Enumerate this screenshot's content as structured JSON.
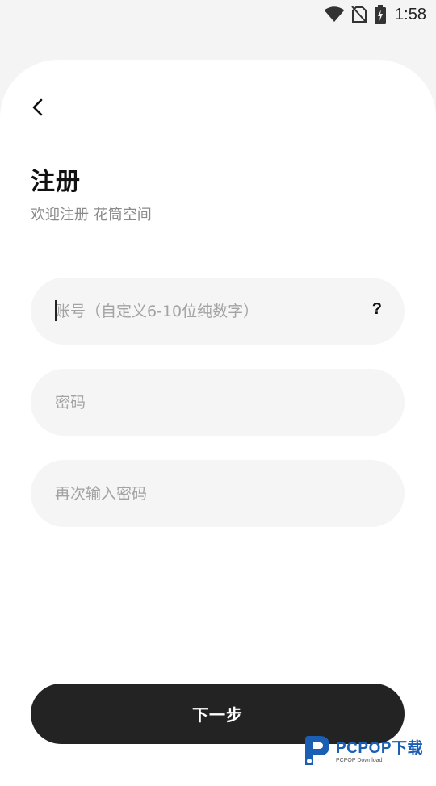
{
  "status_bar": {
    "time": "1:58",
    "icons": [
      "wifi-icon",
      "no-sim-icon",
      "battery-charging-icon"
    ]
  },
  "header": {
    "back_icon": "chevron-left-icon",
    "title": "注册",
    "subtitle": "欢迎注册 花筒空间"
  },
  "form": {
    "account_placeholder": "账号（自定义6-10位纯数字）",
    "account_value": "",
    "help_label": "?",
    "password_placeholder": "密码",
    "password_value": "",
    "confirm_placeholder": "再次输入密码",
    "confirm_value": ""
  },
  "actions": {
    "next_label": "下一步"
  },
  "watermark": {
    "main": "PCPOP下载",
    "sub": "PCPOP Download"
  },
  "colors": {
    "background": "#f4f4f4",
    "card": "#ffffff",
    "field": "#f5f5f5",
    "button": "#232323",
    "watermark_blue": "#1a5fb4"
  }
}
